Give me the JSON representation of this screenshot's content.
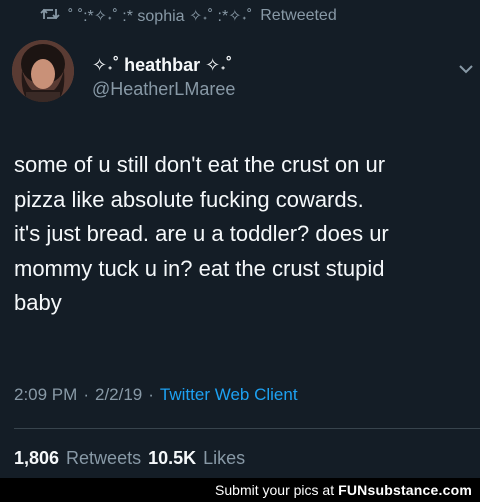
{
  "retweet": {
    "icon": "retweet-icon",
    "user": "˚ ˚:*✧˖˚ :* sophia ✧˖˚ :*✧˖˚",
    "label": "Retweeted"
  },
  "author": {
    "display_name": "✧˖˚ heathbar ✧˖˚",
    "handle": "@HeatherLMaree"
  },
  "tweet": {
    "lines": [
      "some of u still don't eat the crust on ur",
      "pizza like absolute fucking cowards.",
      "it's just bread. are u a toddler? does ur",
      "mommy tuck u in? eat the crust stupid",
      "baby"
    ]
  },
  "meta": {
    "time": "2:09 PM",
    "date": "2/2/19",
    "sep": "·",
    "client": "Twitter Web Client"
  },
  "stats": {
    "retweets_count": "1,806",
    "retweets_label": "Retweets",
    "likes_count": "10.5K",
    "likes_label": "Likes"
  },
  "footer": {
    "prefix": "Submit your pics at",
    "brand": "FUNsubstance.com"
  },
  "colors": {
    "background": "#141d26",
    "secondary_text": "#8899a6",
    "link": "#1da1f2"
  }
}
